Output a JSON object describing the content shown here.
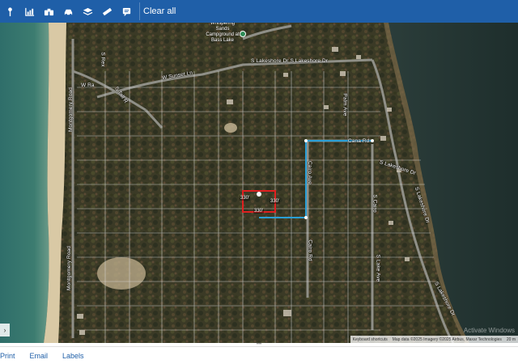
{
  "toolbar": {
    "buttons": [
      {
        "icon": "map-pin-icon"
      },
      {
        "icon": "chart-icon"
      },
      {
        "icon": "binoculars-icon"
      },
      {
        "icon": "car-icon"
      },
      {
        "icon": "layers-icon"
      },
      {
        "icon": "ruler-icon"
      },
      {
        "icon": "note-icon"
      }
    ],
    "clear_all": "Clear all",
    "bg_color": "#1f5fa8"
  },
  "map": {
    "roads": {
      "w_sunset_ln": "W Sunset Ln",
      "s_lakeshore_dr_top": "S Lakeshore Dr S Lakeshore Dr",
      "s_lakeshore_dr_right": "S Lakeshore Dr",
      "s_lakeshore_dr_right2": "S Lakeshore Dr",
      "s_lakeshore_dr_bottom": "S Lakeshore Dr",
      "s_tall_r": "S Tall R",
      "s_rex": "S Rex",
      "montgomery_rd_1": "Montgomery Road",
      "montgomery_rd_2": "Montgomery Road",
      "cairo_ave": "Cairo Ave",
      "cairo_rd": "Cairo Rd",
      "cana_rd": "Cana Rd",
      "palm_ave": "Palm Ave",
      "lake_ave": "S Lake Ave",
      "w_ra": "W Ra",
      "s_cairo": "S Cairo"
    },
    "poi": "Whispering Sands Campground at Bass Lake",
    "parcel_dims": {
      "left": "330'",
      "right": "330'",
      "bottom": "330'"
    },
    "attribution": {
      "shortcuts": "Keyboard shortcuts",
      "data": "Map data ©2025 Imagery ©2025 Airbus, Maxar Technologies",
      "scale": "20 m"
    },
    "watermark": "Activate Windows",
    "colors": {
      "parcel_highlight": "#e02020",
      "route": "#2a9fd6",
      "parcel_lines": "#d8d8d8"
    }
  },
  "bottom": {
    "print": "Print",
    "email": "Email",
    "labels": "Labels"
  }
}
